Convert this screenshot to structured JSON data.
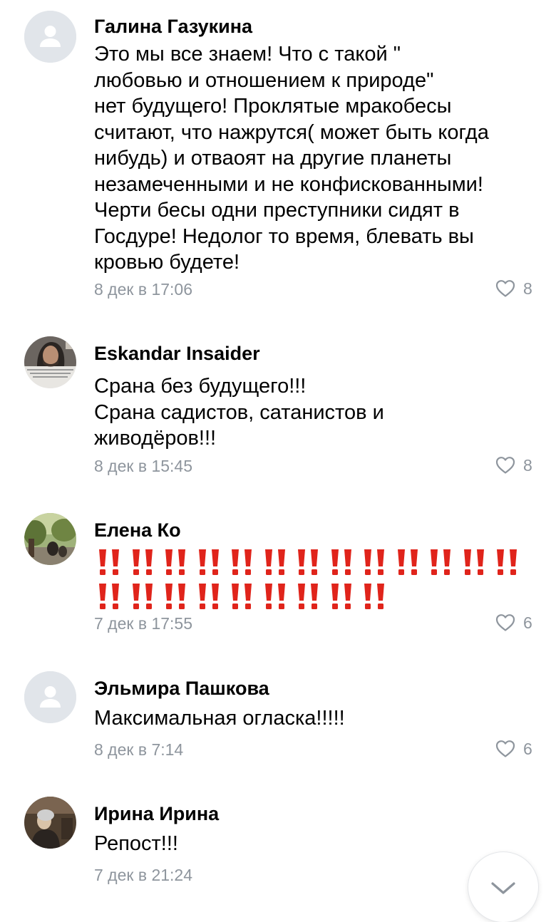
{
  "comments": [
    {
      "author": "Галина Газукина",
      "avatar": "default-avatar-icon",
      "lines": [
        "Это мы все знаем! Что с такой \"",
        "любовью и отношением к природе\"",
        "нет будущего! Проклятые мракобесы",
        "считают, что нажрутся( может быть когда",
        "нибудь) и отваоят на другие планеты",
        "незамеченными и не конфискованными!",
        "Черти бесы одни преступники сидят в",
        "Госдуре! Недолог то время, блевать вы",
        "кровью будете!"
      ],
      "date": "8 дек в 17:06",
      "likes": "8"
    },
    {
      "author": "Eskandar Insaider",
      "avatar": "user-photo-avatar",
      "lines": [
        "Срана без будущего!!!",
        "Срана садистов, сатанистов и",
        "живодёров!!!"
      ],
      "date": "8 дек в 15:45",
      "likes": "8"
    },
    {
      "author": "Елена Ко",
      "avatar": "user-photo-avatar",
      "emoji": "double-exclamation-mark-emoji",
      "emoji_rows": [
        13,
        9
      ],
      "date": "7 дек в 17:55",
      "likes": "6"
    },
    {
      "author": "Эльмира Пашкова",
      "avatar": "default-avatar-icon",
      "lines": [
        "Максимальная огласка!!!!!"
      ],
      "date": "8 дек в 7:14",
      "likes": "6"
    },
    {
      "author": "Ирина Ирина",
      "avatar": "user-photo-avatar",
      "lines": [
        "Репост!!!"
      ],
      "date": "7 дек в 21:24",
      "likes": ""
    }
  ],
  "scroll_button_icon": "chevron-down-icon",
  "colors": {
    "meta_text": "#8e959d",
    "avatar_placeholder": "#e1e5ea",
    "emoji_red": "#e0241b"
  }
}
